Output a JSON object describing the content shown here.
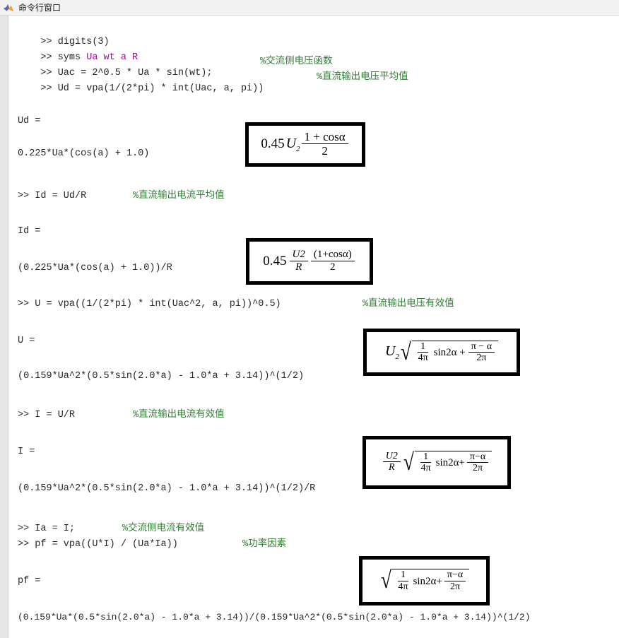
{
  "window": {
    "title": "命令行窗口",
    "icon": "matlab-logo-icon"
  },
  "colors": {
    "background": "#ffffff",
    "titlebar": "#f2f2f2",
    "gutter": "#e6e6e6",
    "text": "#262626",
    "symbolic_variable": "#aa00aa",
    "comment": "#2e7d32",
    "annotation_border": "#000000"
  },
  "console": {
    "prompt": ">> ",
    "lines": [
      {
        "id": "l1",
        "type": "command",
        "text": ">> digits(3)"
      },
      {
        "id": "l2",
        "type": "command",
        "code": ">> syms ",
        "symbols": "Ua wt a R"
      },
      {
        "id": "l3",
        "type": "command",
        "text": ">> Uac = 2^0.5 * Ua * sin(wt);",
        "comment": "%交流侧电压函数"
      },
      {
        "id": "l4",
        "type": "command",
        "text": ">> Ud = vpa(1/(2*pi) * int(Uac, a, pi))",
        "comment": "%直流输出电压平均值"
      },
      {
        "id": "l5",
        "type": "output",
        "text": "Ud ="
      },
      {
        "id": "l6",
        "type": "output",
        "text": "0.225*Ua*(cos(a) + 1.0)"
      },
      {
        "id": "l7",
        "type": "command",
        "text": ">> Id = Ud/R",
        "comment": "%直流输出电流平均值"
      },
      {
        "id": "l8",
        "type": "output",
        "text": "Id ="
      },
      {
        "id": "l9",
        "type": "output",
        "text": "(0.225*Ua*(cos(a) + 1.0))/R"
      },
      {
        "id": "l10",
        "type": "command",
        "text": ">> U = vpa((1/(2*pi) * int(Uac^2, a, pi))^0.5)",
        "comment": "%直流输出电压有效值"
      },
      {
        "id": "l11",
        "type": "output",
        "text": "U ="
      },
      {
        "id": "l12",
        "type": "output",
        "text": "(0.159*Ua^2*(0.5*sin(2.0*a) - 1.0*a + 3.14))^(1/2)"
      },
      {
        "id": "l13",
        "type": "command",
        "text": ">> I = U/R",
        "comment": "%直流输出电流有效值"
      },
      {
        "id": "l14",
        "type": "output",
        "text": "I ="
      },
      {
        "id": "l15",
        "type": "output",
        "text": "(0.159*Ua^2*(0.5*sin(2.0*a) - 1.0*a + 3.14))^(1/2)/R"
      },
      {
        "id": "l16",
        "type": "command",
        "text": ">> Ia = I;",
        "comment": "%交流侧电流有效值"
      },
      {
        "id": "l17",
        "type": "command",
        "text": ">> pf = vpa((U*I) / (Ua*Ia))",
        "comment": "%功率因素"
      },
      {
        "id": "l18",
        "type": "output",
        "text": "pf ="
      },
      {
        "id": "l19",
        "type": "output",
        "text": "(0.159*Ua*(0.5*sin(2.0*a) - 1.0*a + 3.14))/(0.159*Ua^2*(0.5*sin(2.0*a) - 1.0*a + 3.14))^(1/2)"
      }
    ]
  },
  "annotations": [
    {
      "id": "ann1",
      "name": "formula-ud-average-voltage",
      "latex": "0.45 U_2 \\frac{1+\\cos\\alpha}{2}",
      "plain": "0.45U2 (1+cosα)/2",
      "lead": "0.45",
      "var": "U",
      "sub": "2",
      "numerator": "1 + cosα",
      "denominator": "2"
    },
    {
      "id": "ann2",
      "name": "formula-id-average-current",
      "latex": "0.45 \\frac{U_2}{R}\\frac{(1+\\cos\\alpha)}{2}",
      "plain": "0.45 U2/R (1+cosα)/2",
      "lead": "0.45",
      "frac1_num": "U2",
      "frac1_den": "R",
      "frac2_num": "(1+cosα)",
      "frac2_den": "2"
    },
    {
      "id": "ann3",
      "name": "formula-u-rms-voltage",
      "latex": "U_2\\sqrt{\\frac{1}{4\\pi}\\sin 2\\alpha + \\frac{\\pi-\\alpha}{2\\pi}}",
      "plain": "U2 √(1/(4π) sin2α + (π−α)/(2π))",
      "var": "U",
      "sub": "2",
      "frac1_num": "1",
      "frac1_den": "4π",
      "mid": "sin2α +",
      "frac2_num": "π − α",
      "frac2_den": "2π"
    },
    {
      "id": "ann4",
      "name": "formula-i-rms-current",
      "latex": "\\frac{U_2}{R}\\sqrt{\\frac{1}{4\\pi}\\sin 2\\alpha + \\frac{\\pi-\\alpha}{2\\pi}}",
      "plain": "U2/R √(1/(4π) sin2α + (π−α)/(2π))",
      "frac0_num": "U2",
      "frac0_den": "R",
      "frac1_num": "1",
      "frac1_den": "4π",
      "mid": "sin2α+",
      "frac2_num": "π−α",
      "frac2_den": "2π"
    },
    {
      "id": "ann5",
      "name": "formula-pf-power-factor",
      "latex": "\\sqrt{\\frac{1}{4\\pi}\\sin 2\\alpha + \\frac{\\pi-\\alpha}{2\\pi}}",
      "plain": "√(1/(4π) sin2α + (π−α)/(2π))",
      "frac1_num": "1",
      "frac1_den": "4π",
      "mid": "sin2α+",
      "frac2_num": "π−α",
      "frac2_den": "2π"
    }
  ]
}
